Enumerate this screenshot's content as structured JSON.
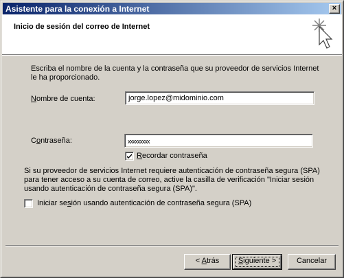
{
  "window": {
    "title": "Asistente para la conexión a Internet",
    "close_glyph": "×"
  },
  "header": {
    "title": "Inicio de sesión del correo de Internet",
    "icon": "wizard-sparkle-cursor-icon"
  },
  "intro_text": "Escriba el nombre de la cuenta y la contraseña que su proveedor de servicios Internet le ha proporcionado.",
  "account": {
    "label_pre": "",
    "label_key": "N",
    "label_post": "ombre de cuenta:",
    "value": "jorge.lopez@midominio.com"
  },
  "password": {
    "label_pre": "C",
    "label_key": "o",
    "label_post": "ntraseña:",
    "value": "xxxxxxxxx"
  },
  "remember": {
    "label_pre": "",
    "label_key": "R",
    "label_post": "ecordar contraseña",
    "checked": true
  },
  "spa_text": "Si su proveedor de servicios Internet requiere autenticación de contraseña segura (SPA) para tener acceso a su cuenta de correo, active la casilla de verificación \"Iniciar sesión usando autenticación de contraseña segura (SPA)\".",
  "spa_checkbox": {
    "label_pre": "Iniciar se",
    "label_key": "s",
    "label_post": "ión usando autenticación de contraseña segura (SPA)",
    "checked": false
  },
  "buttons": {
    "back": {
      "pre": "< ",
      "key": "A",
      "post": "trás"
    },
    "next": {
      "pre": "",
      "key": "S",
      "post": "iguiente >"
    },
    "cancel": {
      "label": "Cancelar"
    }
  }
}
